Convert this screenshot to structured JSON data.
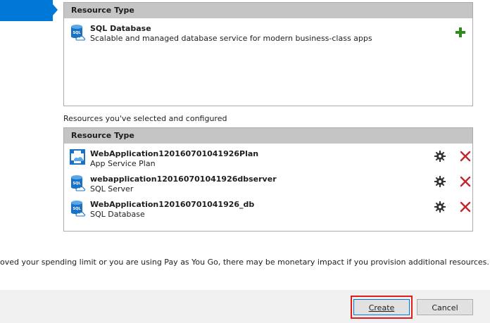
{
  "available": {
    "header": "Resource Type",
    "items": [
      {
        "name": "SQL Database",
        "description": "Scalable and managed database service for modern business-class apps",
        "icon": "sql-database-icon",
        "action_icon": "add-icon"
      }
    ]
  },
  "selected": {
    "label": "Resources you've selected and configured",
    "header": "Resource Type",
    "items": [
      {
        "name": "WebApplication120160701041926Plan",
        "type": "App Service Plan",
        "icon": "app-service-plan-icon"
      },
      {
        "name": "webapplication120160701041926dbserver",
        "type": "SQL Server",
        "icon": "sql-server-icon"
      },
      {
        "name": "WebApplication120160701041926_db",
        "type": "SQL Database",
        "icon": "sql-database-icon"
      }
    ],
    "action_icons": [
      "gear-icon",
      "delete-icon"
    ]
  },
  "notice": "oved your spending limit or you are using Pay as You Go, there may be monetary impact if you provision additional resources.",
  "buttons": {
    "create": "Create",
    "cancel": "Cancel"
  },
  "colors": {
    "accent": "#0078d7",
    "add": "#2e8b1e",
    "delete": "#c1272d",
    "highlight": "#e21b1b",
    "header_bg": "#c5c5c5"
  }
}
